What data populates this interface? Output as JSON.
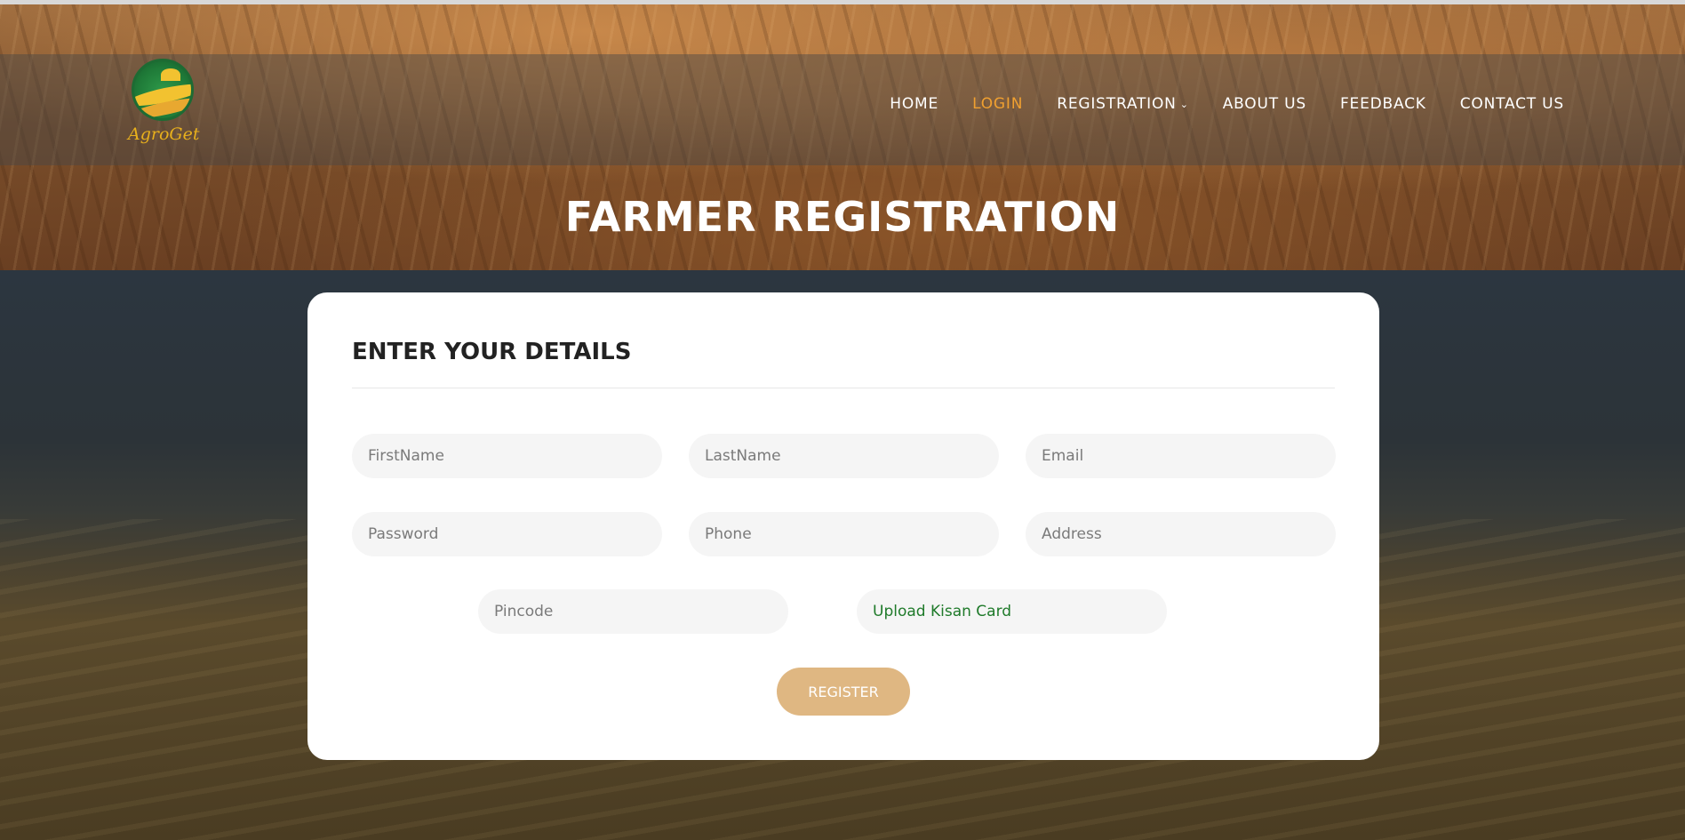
{
  "brand": {
    "name": "AgroGet"
  },
  "nav": {
    "items": [
      {
        "label": "HOME"
      },
      {
        "label": "LOGIN"
      },
      {
        "label": "REGISTRATION"
      },
      {
        "label": "ABOUT US"
      },
      {
        "label": "FEEDBACK"
      },
      {
        "label": "CONTACT US"
      }
    ],
    "active": "LOGIN"
  },
  "hero": {
    "title": "FARMER REGISTRATION"
  },
  "form": {
    "title": "ENTER YOUR DETAILS",
    "fields": {
      "firstname": {
        "placeholder": "FirstName"
      },
      "lastname": {
        "placeholder": "LastName"
      },
      "email": {
        "placeholder": "Email"
      },
      "password": {
        "placeholder": "Password"
      },
      "phone": {
        "placeholder": "Phone"
      },
      "address": {
        "placeholder": "Address"
      },
      "pincode": {
        "placeholder": "Pincode"
      },
      "upload": {
        "label": "Upload Kisan Card"
      }
    },
    "submit_label": "REGISTER"
  },
  "colors": {
    "accent": "#f0a030",
    "button": "#dfb782",
    "upload_text": "#1f7a2a"
  }
}
